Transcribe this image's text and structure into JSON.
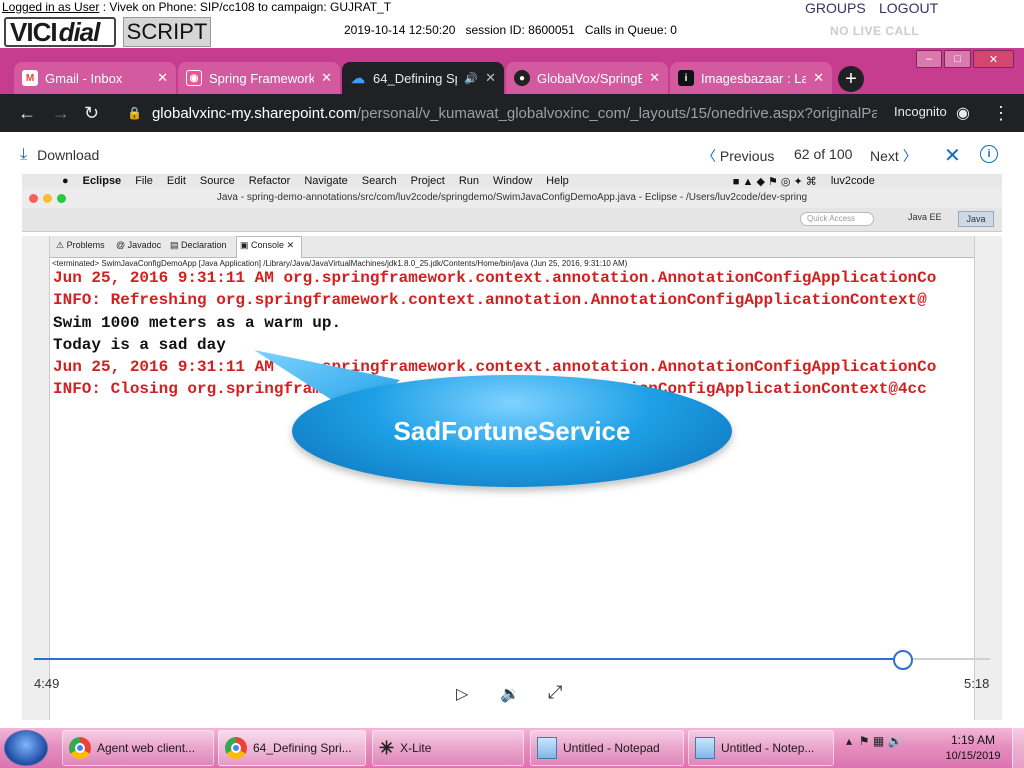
{
  "vicidial": {
    "logged_prefix": "Logged in as User",
    "logged_rest": " : Vivek on Phone: SIP/cc108  to campaign: GUJRAT_T",
    "logo_vici": "VICI",
    "logo_dial": "dial",
    "script_label": "SCRIPT",
    "timestamp": "2019-10-14 12:50:20",
    "session_label": "session ID: 8600051",
    "calls_label": "Calls in Queue: 0",
    "groups": "GROUPS",
    "logout": "LOGOUT",
    "no_live_call": "NO LIVE CALL"
  },
  "chrome": {
    "tabs": [
      {
        "label": "Gmail - Inbox",
        "icon": "gmail-icon"
      },
      {
        "label": "Spring Framework",
        "icon": "spring-icon"
      },
      {
        "label": "64_Defining Sp",
        "icon": "onedrive-icon"
      },
      {
        "label": "GlobalVox/SpringB",
        "icon": "github-icon"
      },
      {
        "label": "Imagesbazaar : Lar",
        "icon": "imagesbazaar-icon"
      }
    ],
    "url_host": "globalvxinc-my.sharepoint.com",
    "url_path": "/personal/v_kumawat_globalvoxinc_com/_layouts/15/onedrive.aspx?originalPa...",
    "incognito": "Incognito",
    "colors": {
      "frame": "#c63c8e",
      "toolbar": "#202124"
    }
  },
  "viewer": {
    "download": "Download",
    "previous": "Previous",
    "page_count": "62 of 100",
    "next": "Next"
  },
  "eclipse": {
    "mac_menu": [
      "Eclipse",
      "File",
      "Edit",
      "Source",
      "Refactor",
      "Navigate",
      "Search",
      "Project",
      "Run",
      "Window",
      "Help"
    ],
    "mac_user": "luv2code",
    "title": "Java - spring-demo-annotations/src/com/luv2code/springdemo/SwimJavaConfigDemoApp.java - Eclipse - /Users/luv2code/dev-spring",
    "quick_access": "Quick Access",
    "persp_javaee": "Java EE",
    "persp_java": "Java",
    "view_tabs": [
      "Problems",
      "Javadoc",
      "Declaration",
      "Console"
    ],
    "terminated": "<terminated> SwimJavaConfigDemoApp [Java Application] /Library/Java/JavaVirtualMachines/jdk1.8.0_25.jdk/Contents/Home/bin/java (Jun 25, 2016, 9:31:10 AM)",
    "console_lines": [
      {
        "text": "Jun 25, 2016 9:31:11 AM org.springframework.context.annotation.AnnotationConfigApplicationCo",
        "color": "red"
      },
      {
        "text": "INFO: Refreshing org.springframework.context.annotation.AnnotationConfigApplicationContext@",
        "color": "red"
      },
      {
        "text": "Swim 1000 meters as a warm up.",
        "color": "black"
      },
      {
        "text": "Today is a sad day",
        "color": "black"
      },
      {
        "text": "Jun 25, 2016 9:31:11 AM org.springframework.context.annotation.AnnotationConfigApplicationCo",
        "color": "red"
      },
      {
        "text": "INFO: Closing org.springframework.context.annotation.AnnotationConfigApplicationContext@4cc",
        "color": "red"
      }
    ],
    "callout": "SadFortuneService"
  },
  "video": {
    "current_time": "4:49",
    "total_time": "5:18",
    "progress_fraction": 0.909
  },
  "taskbar": {
    "items": [
      {
        "label": "Agent web client...",
        "icon": "chrome-icon"
      },
      {
        "label": "64_Defining Spri...",
        "icon": "chrome-icon"
      },
      {
        "label": "X-Lite",
        "icon": "xlite-icon"
      },
      {
        "label": "Untitled - Notepad",
        "icon": "notepad-icon"
      },
      {
        "label": "Untitled - Notep...",
        "icon": "notepad-icon"
      }
    ],
    "time": "1:19 AM",
    "date": "10/15/2019"
  }
}
